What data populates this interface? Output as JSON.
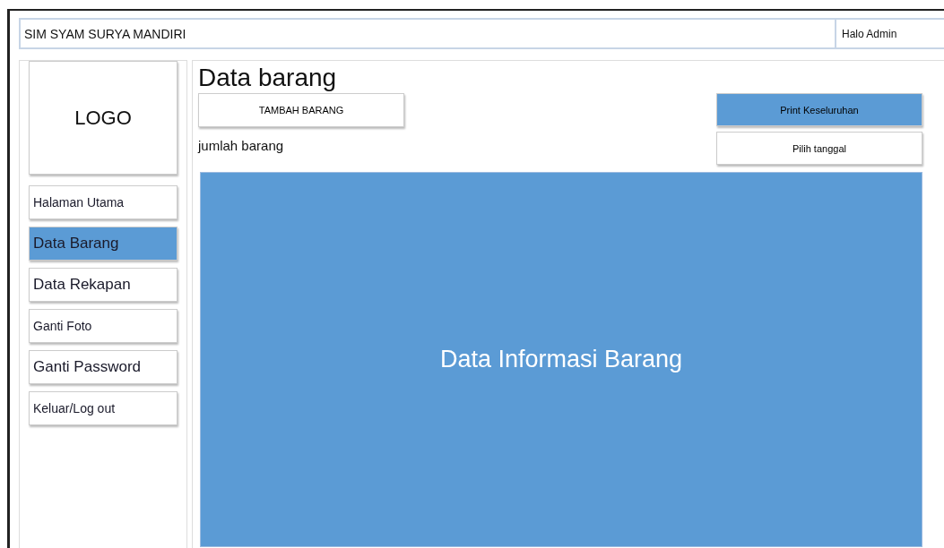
{
  "header": {
    "title": "SIM SYAM SURYA MANDIRI",
    "greeting": "Halo Admin"
  },
  "sidebar": {
    "logo": "LOGO",
    "items": [
      {
        "label": "Halaman Utama",
        "selected": false
      },
      {
        "label": "Data Barang",
        "selected": true
      },
      {
        "label": "Data Rekapan",
        "selected": false
      },
      {
        "label": "Ganti Foto",
        "selected": false
      },
      {
        "label": "Ganti Password",
        "selected": false
      },
      {
        "label": "Keluar/Log out",
        "selected": false
      }
    ]
  },
  "content": {
    "title": "Data barang",
    "add_button": "TAMBAH BARANG",
    "count_label": "jumlah barang",
    "print_button": "Print Keseluruhan",
    "date_button": "Pilih tanggal",
    "panel_text": "Data Informasi Barang"
  }
}
